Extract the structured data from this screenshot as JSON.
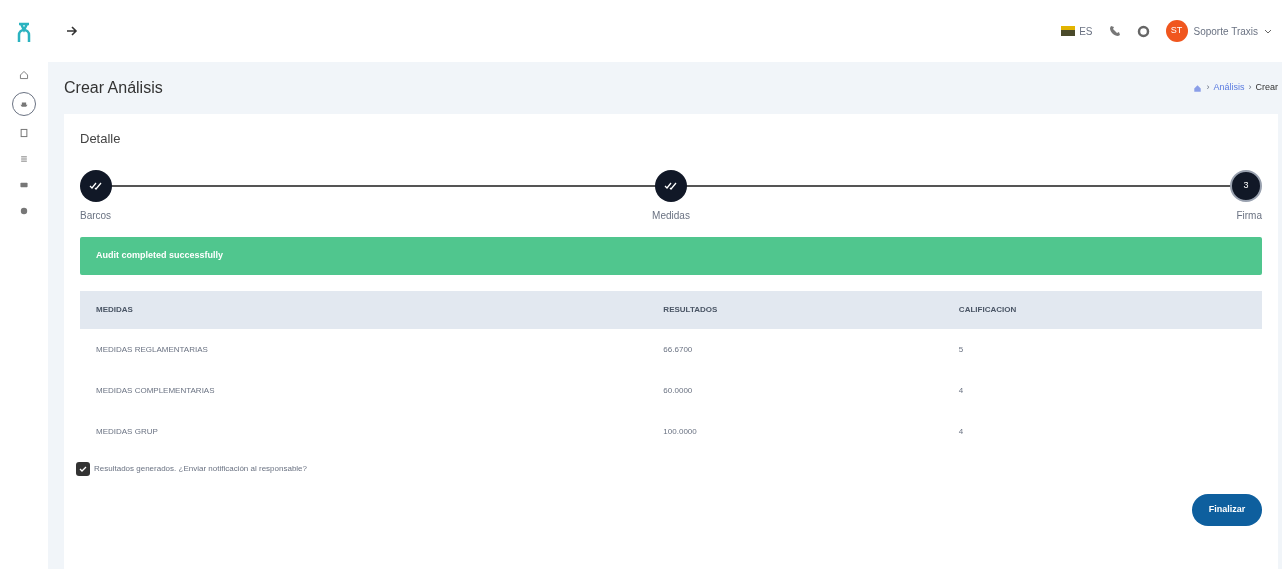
{
  "topbar": {
    "language": "ES",
    "user": {
      "initials": "ST",
      "name": "Soporte Traxis"
    }
  },
  "sidebar": {
    "items": [
      {
        "selected": false
      },
      {
        "selected": true
      },
      {
        "selected": false
      },
      {
        "selected": false
      },
      {
        "selected": false
      },
      {
        "selected": false
      }
    ]
  },
  "page": {
    "title": "Crear Análisis",
    "breadcrumb_separator": "›",
    "breadcrumb": [
      "Análisis",
      "Crear"
    ]
  },
  "card": {
    "title": "Detalle",
    "steps": [
      {
        "label": "Barcos",
        "completed": true
      },
      {
        "label": "Medidas",
        "completed": true
      },
      {
        "label": "Firma",
        "number": "3",
        "completed": false
      }
    ],
    "alert": "Audit completed successfully",
    "table": {
      "columns": [
        "MEDIDAS",
        "RESULTADOS",
        "CALIFICACION"
      ],
      "rows": [
        [
          "MEDIDAS REGLAMENTARIAS",
          "66.6700",
          "5"
        ],
        [
          "MEDIDAS COMPLEMENTARIAS",
          "60.0000",
          "4"
        ],
        [
          "MEDIDAS GRUP",
          "100.0000",
          "4"
        ]
      ]
    },
    "checkbox": {
      "label": "Resultados generados. ¿Enviar notificación al responsable?",
      "checked": true
    },
    "button": "Finalizar"
  }
}
